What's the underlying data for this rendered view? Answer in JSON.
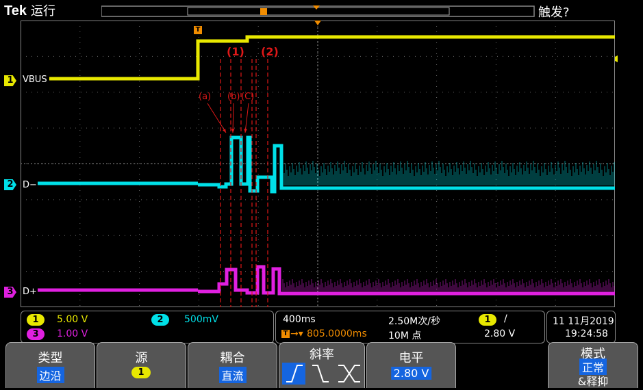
{
  "header": {
    "brand": "Tek",
    "run_state": "运行",
    "trigger_status": "触发?"
  },
  "channels": [
    {
      "num": "1",
      "name": "VBUS",
      "color": "#e8e800",
      "scale": "5.00 V"
    },
    {
      "num": "2",
      "name": "D−",
      "color": "#00e0e8",
      "scale": "500mV"
    },
    {
      "num": "3",
      "name": "D+",
      "color": "#e020e0",
      "scale": "1.00 V"
    }
  ],
  "annotations": {
    "phase1": "(1)",
    "phase2": "(2)",
    "a": "(a)",
    "b": "(b)",
    "c": "(C)"
  },
  "markers": {
    "trigger_pos": "T"
  },
  "timebase": {
    "time_div": "400ms",
    "sample_rate": "2.50M次/秒",
    "trigger_delay": "805.0000ms",
    "record_length": "10M 点"
  },
  "trigger": {
    "source_num": "1",
    "slope_symbol": "/",
    "level": "2.80 V"
  },
  "datetime": {
    "date": "11 11月2019",
    "time": "19:24:58"
  },
  "menu": {
    "type_label": "类型",
    "type_value": "边沿",
    "source_label": "源",
    "source_value": "1",
    "coupling_label": "耦合",
    "coupling_value": "直流",
    "slope_label": "斜率",
    "level_label": "电平",
    "level_value": "2.80 V",
    "mode_label": "模式",
    "mode_value": "正常",
    "mode_extra": "&释抑"
  },
  "colors": {
    "ch1": "#e8e800",
    "ch2": "#00e0e8",
    "ch3": "#e020e0",
    "grid": "#6a6a6a",
    "annotation": "#e01818",
    "trigger": "#f08c00",
    "menu_highlight": "#1565e0"
  }
}
